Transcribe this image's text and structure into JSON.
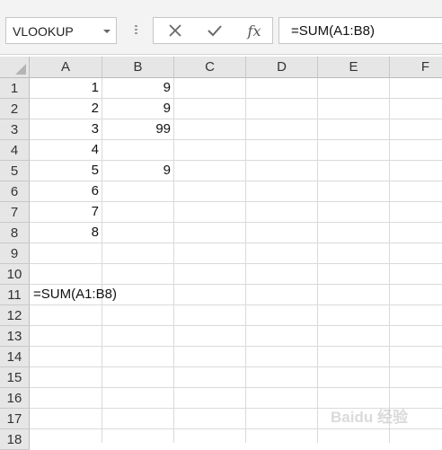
{
  "name_box": {
    "value": "VLOOKUP"
  },
  "formula_bar": {
    "cancel_icon": "close-icon",
    "enter_icon": "checkmark-icon",
    "function_label": "fx",
    "formula": "=SUM(A1:B8)"
  },
  "columns": [
    "A",
    "B",
    "C",
    "D",
    "E",
    "F"
  ],
  "rows": [
    "1",
    "2",
    "3",
    "4",
    "5",
    "6",
    "7",
    "8",
    "9",
    "10",
    "11",
    "12",
    "13",
    "14",
    "15",
    "16",
    "17",
    "18"
  ],
  "cells": {
    "A1": "1",
    "B1": "9",
    "A2": "2",
    "B2": "9",
    "A3": "3",
    "B3": "99",
    "A4": "4",
    "A5": "5",
    "B5": "9",
    "A6": "6",
    "A7": "7",
    "A8": "8",
    "A11": "=SUM(A1:B8)"
  },
  "watermark": {
    "text": "Baidu 经验"
  },
  "colors": {
    "header_bg": "#e6e6e6",
    "gridline": "#dadada"
  }
}
